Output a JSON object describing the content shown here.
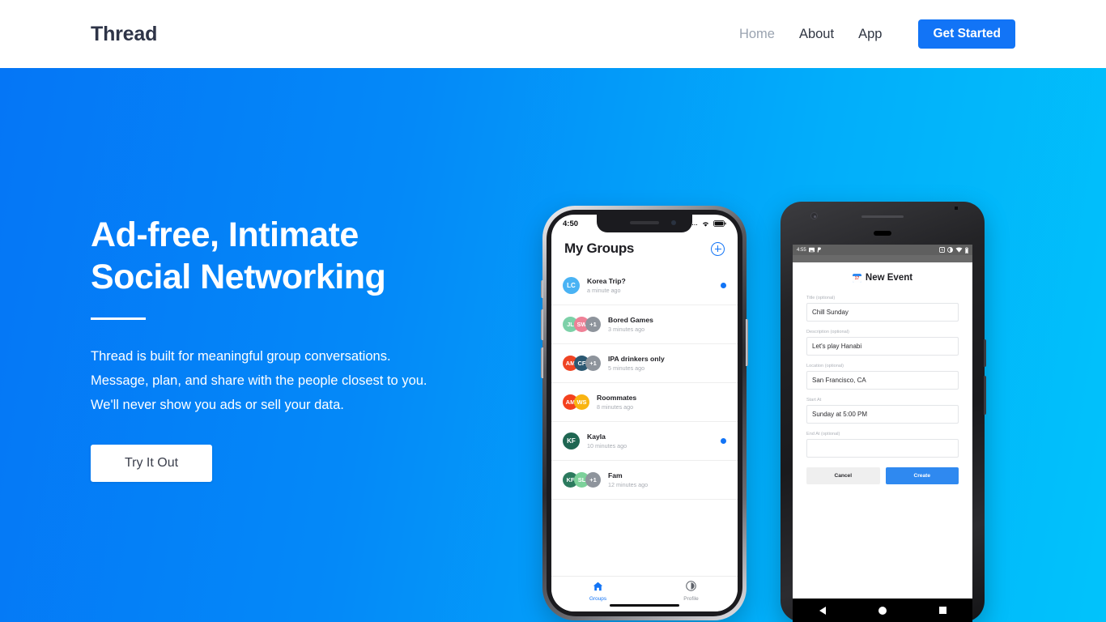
{
  "navbar": {
    "brand": "Thread",
    "links": [
      {
        "label": "Home",
        "active": true
      },
      {
        "label": "About",
        "active": false
      },
      {
        "label": "App",
        "active": false
      }
    ],
    "cta": "Get Started"
  },
  "hero": {
    "title_line1": "Ad-free, Intimate",
    "title_line2": "Social Networking",
    "subtitle": "Thread is built for meaningful group conversations. Message, plan, and share with the people closest to you. We'll never show you ads or sell your data.",
    "button": "Try It Out",
    "gradient_from": "#0576f6",
    "gradient_to": "#01c3fb"
  },
  "iphone": {
    "status": {
      "time": "4:50",
      "signal": "....",
      "wifi": "wifi-icon",
      "battery": "battery-icon"
    },
    "header": {
      "title": "My Groups",
      "add_button": "add-group-button"
    },
    "groups": [
      {
        "name": "Korea Trip?",
        "time": "a minute ago",
        "unread": true,
        "avatars": [
          {
            "initials": "LC",
            "color": "#4ab3f4"
          }
        ]
      },
      {
        "name": "Bored Games",
        "time": "3 minutes ago",
        "unread": false,
        "avatars": [
          {
            "initials": "JL",
            "color": "#7dd1a8"
          },
          {
            "initials": "SW",
            "color": "#ef8197"
          },
          {
            "initials": "+1",
            "color": "#8e949c"
          }
        ]
      },
      {
        "name": "IPA drinkers only",
        "time": "5 minutes ago",
        "unread": false,
        "avatars": [
          {
            "initials": "AM",
            "color": "#ef4423"
          },
          {
            "initials": "CF",
            "color": "#2b5872"
          },
          {
            "initials": "+1",
            "color": "#8e949c"
          }
        ]
      },
      {
        "name": "Roommates",
        "time": "8 minutes ago",
        "unread": false,
        "avatars": [
          {
            "initials": "AM",
            "color": "#f4411e"
          },
          {
            "initials": "WS",
            "color": "#f9b411"
          }
        ]
      },
      {
        "name": "Kayla",
        "time": "10 minutes ago",
        "unread": true,
        "avatars": [
          {
            "initials": "KF",
            "color": "#1f6652"
          }
        ]
      },
      {
        "name": "Fam",
        "time": "12 minutes ago",
        "unread": false,
        "avatars": [
          {
            "initials": "KF",
            "color": "#2c7a5e"
          },
          {
            "initials": "SL",
            "color": "#7cd19a"
          },
          {
            "initials": "+1",
            "color": "#8e949c"
          }
        ]
      }
    ],
    "tabs": [
      {
        "label": "Groups",
        "icon": "home-icon",
        "active": true
      },
      {
        "label": "Profile",
        "icon": "profile-icon",
        "active": false
      }
    ]
  },
  "android": {
    "status": {
      "time": "4:55",
      "icons": [
        "image-icon",
        "paypal-icon",
        "alarm-icon",
        "dnd-icon",
        "wifi-icon",
        "battery-icon"
      ]
    },
    "header": {
      "title": "New Event",
      "icon": "calendar-icon"
    },
    "fields": [
      {
        "label": "Title (optional)",
        "value": "Chill Sunday"
      },
      {
        "label": "Description (optional)",
        "value": "Let's play Hanabi"
      },
      {
        "label": "Location (optional)",
        "value": "San Francisco, CA"
      },
      {
        "label": "Start At",
        "value": "Sunday at 5:00 PM"
      },
      {
        "label": "End At (optional)",
        "value": ""
      }
    ],
    "buttons": {
      "cancel": "Cancel",
      "create": "Create"
    },
    "navbar": {
      "back": "back-button",
      "home": "home-button",
      "recents": "recents-button"
    }
  }
}
